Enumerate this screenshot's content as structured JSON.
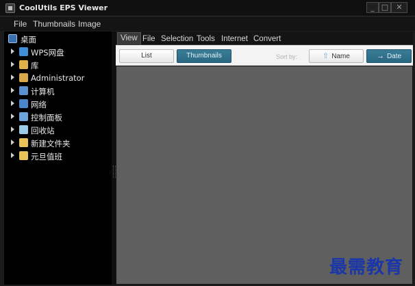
{
  "window": {
    "title": "CoolUtils EPS Viewer",
    "controls": {
      "minimize": "_",
      "maximize": "□",
      "close": "✕"
    }
  },
  "menu": [
    "File",
    "Thumbnails",
    "Image"
  ],
  "tree": {
    "root": {
      "label": "桌面",
      "icon": "desktop-icon"
    },
    "items": [
      {
        "label": "WPS网盘",
        "icon": "cloud-drive-icon",
        "color": "#3f8fd8"
      },
      {
        "label": "库",
        "icon": "library-icon",
        "color": "#e1b24a"
      },
      {
        "label": "Administrator",
        "icon": "user-folder-icon",
        "color": "#d8a84a"
      },
      {
        "label": "计算机",
        "icon": "computer-icon",
        "color": "#5b8fd0"
      },
      {
        "label": "网络",
        "icon": "network-icon",
        "color": "#4b86c8"
      },
      {
        "label": "控制面板",
        "icon": "control-panel-icon",
        "color": "#6aa4d8"
      },
      {
        "label": "回收站",
        "icon": "recycle-bin-icon",
        "color": "#9ccbe8"
      },
      {
        "label": "新建文件夹",
        "icon": "folder-icon",
        "color": "#e8c35a"
      },
      {
        "label": "元旦值班",
        "icon": "folder-icon",
        "color": "#e8c35a"
      }
    ]
  },
  "tabs": [
    "View",
    "File",
    "Selection",
    "Tools",
    "Internet",
    "Convert"
  ],
  "active_tab": "View",
  "toolbar": {
    "list_label": "List",
    "thumbnails_label": "Thumbnails",
    "sort_by_label": "Sort by:",
    "name_label": "Name",
    "date_label": "Date",
    "name_icon": "upload-arrow-icon",
    "date_icon": "arrow-right-icon"
  },
  "watermark": "最需教育",
  "colors": {
    "accent": "#2f7390",
    "viewer_bg": "#5f5f5f",
    "watermark": "#1a36a8"
  }
}
